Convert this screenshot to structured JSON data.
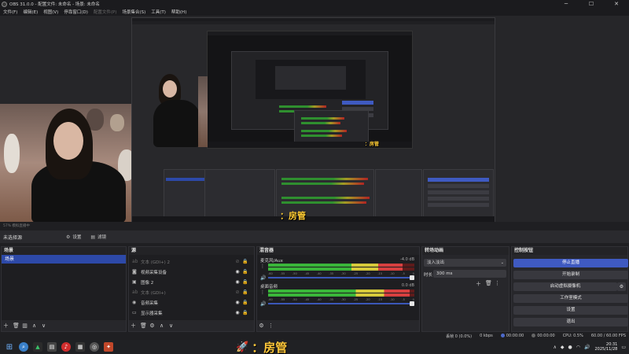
{
  "window": {
    "title": "OBS 31.0.0 - 配置文件: 未命名 - 场景: 未命名",
    "minimize": "─",
    "maximize": "☐",
    "close": "✕"
  },
  "menu": [
    "文件(F)",
    "编辑(E)",
    "视图(V)",
    "停靠窗口(D)",
    "配置文件(P)",
    "场景集合(S)",
    "工具(T)",
    "帮助(H)"
  ],
  "preview": {
    "caption": "：房管",
    "nested_caption": "：房管"
  },
  "strip_text": "57%  模拟直播中",
  "source_bar": {
    "no_source": "未选择源",
    "properties": "设置",
    "filters": "滤镜"
  },
  "scenes": {
    "title": "场景",
    "items": [
      "场景"
    ]
  },
  "sources": {
    "title": "源",
    "items": [
      {
        "label": "文本 (GDI+) 2",
        "icon": "text-icon",
        "glyph": "ab",
        "dim": true
      },
      {
        "label": "视频采集设备",
        "icon": "camera-icon",
        "glyph": "◙",
        "dim": false
      },
      {
        "label": "图像 2",
        "icon": "image-icon",
        "glyph": "▣",
        "dim": false
      },
      {
        "label": "文本 (GDI+)",
        "icon": "text-icon",
        "glyph": "ab",
        "dim": true
      },
      {
        "label": "音频采集",
        "icon": "audio-capture-icon",
        "glyph": "◉",
        "dim": false
      },
      {
        "label": "显示器采集",
        "icon": "monitor-icon",
        "glyph": "▭",
        "dim": false
      }
    ]
  },
  "mixer": {
    "title": "混音器",
    "channels": [
      {
        "name": "麦克风/Aux",
        "db": "-4.0 dB",
        "level": 0.92
      },
      {
        "name": "桌面音频",
        "db": "0.0 dB",
        "level": 0.97
      }
    ],
    "scale": [
      "-60",
      "-55",
      "-50",
      "-45",
      "-40",
      "-35",
      "-30",
      "-25",
      "-20",
      "-15",
      "-10",
      "-5",
      "0"
    ]
  },
  "transitions": {
    "title": "转场动画",
    "selected": "淡入淡出",
    "duration_label": "时长",
    "duration_value": "300 ms"
  },
  "controls": {
    "title": "控制按钮",
    "stop_stream": "停止直播",
    "start_recording": "开始录制",
    "virtual_camera": "启动虚拟摄像机",
    "studio_mode": "工作室模式",
    "settings": "设置",
    "exit": "退出"
  },
  "status": {
    "dropped": "丢帧 0 (0.0%)",
    "bitrate": "0 kbps",
    "stream_time": "00:00:00",
    "rec_time": "00:00:00",
    "cpu": "CPU: 0.5%",
    "fps": "60.00 / 60.00 FPS"
  },
  "taskbar": {
    "caption": "：房管",
    "time": "20:31",
    "date": "2025/11/28"
  },
  "colors": {
    "accent": "#3f5ac1",
    "caption": "#ffcc33"
  }
}
